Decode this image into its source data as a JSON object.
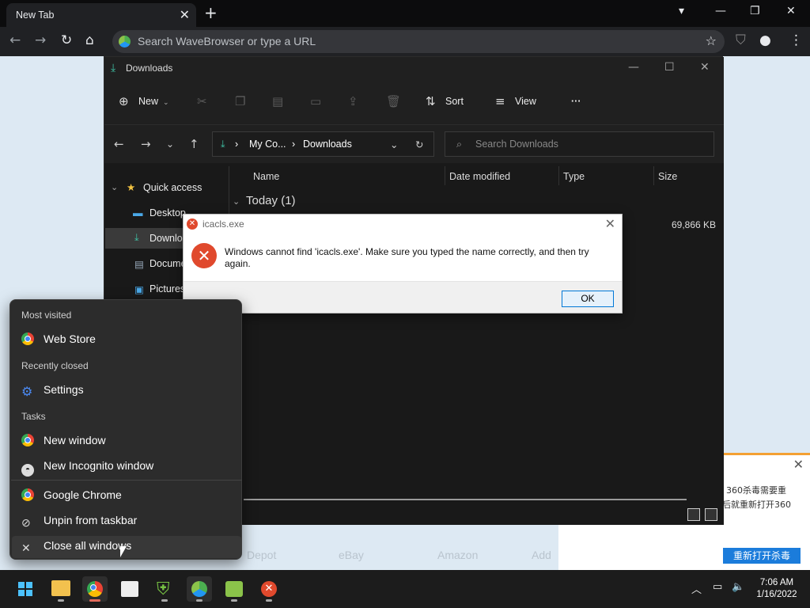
{
  "browser": {
    "tab_title": "New Tab",
    "omnibox_placeholder": "Search WaveBrowser or type a URL"
  },
  "webpage": {
    "shortcuts": [
      "Depot",
      "eBay",
      "Amazon",
      "Add"
    ]
  },
  "popup360": {
    "line1": "360杀毒需要重",
    "line2": "后就重新打开360",
    "button": "重新打开杀毒"
  },
  "explorer": {
    "title": "Downloads",
    "commands": {
      "new": "New",
      "sort": "Sort",
      "view": "View"
    },
    "breadcrumb": {
      "root": "My Co...",
      "current": "Downloads"
    },
    "search_placeholder": "Search Downloads",
    "sidebar": {
      "quick_access": "Quick access",
      "items": [
        "Desktop",
        "Downlo",
        "Docume",
        "Pictures"
      ]
    },
    "columns": {
      "name": "Name",
      "date": "Date modified",
      "type": "Type",
      "size": "Size"
    },
    "group": "Today (1)",
    "file_size": "69,866 KB"
  },
  "dialog": {
    "title": "icacls.exe",
    "message": "Windows cannot find 'icacls.exe'. Make sure you typed the name correctly, and then try again.",
    "ok": "OK"
  },
  "jumplist": {
    "most_visited_header": "Most visited",
    "most_visited": "Web Store",
    "recently_closed_header": "Recently closed",
    "recently_closed": "Settings",
    "tasks_header": "Tasks",
    "task_new_window": "New window",
    "task_incognito": "New Incognito window",
    "app_name": "Google Chrome",
    "unpin": "Unpin from taskbar",
    "close_all": "Close all windows"
  },
  "taskbar": {
    "time": "7:06 AM",
    "date": "1/16/2022"
  }
}
